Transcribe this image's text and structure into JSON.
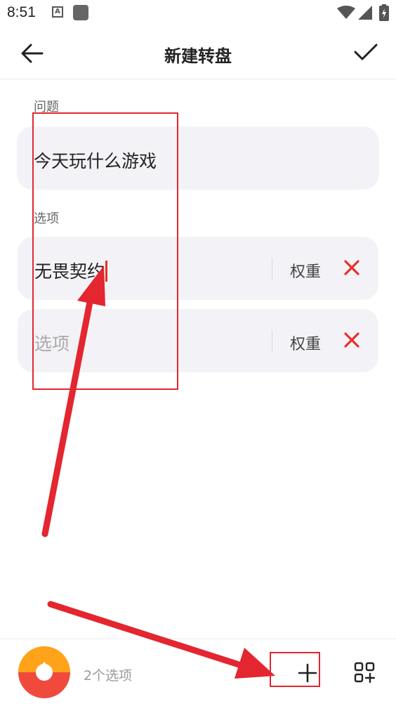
{
  "status_bar": {
    "time": "8:51",
    "a_icon_letter": "A"
  },
  "header": {
    "title": "新建转盘"
  },
  "question": {
    "label": "问题",
    "value": "今天玩什么游戏"
  },
  "options": {
    "label": "选项",
    "items": [
      {
        "value": "无畏契约",
        "weight_label": "权重"
      },
      {
        "value": "",
        "placeholder": "选项",
        "weight_label": "权重"
      }
    ]
  },
  "footer": {
    "option_count": "2个选项"
  },
  "colors": {
    "accent_red": "#e8302b",
    "annotation_red": "#e3262f",
    "card_bg": "#f3f3f7",
    "wheel_orange": "#ffa31a",
    "wheel_red": "#f04a3c"
  }
}
